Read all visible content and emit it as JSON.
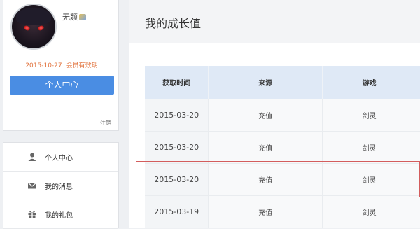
{
  "profile": {
    "username": "无颜",
    "membership_date": "2015-10-27",
    "membership_text": "会员有效期",
    "center_button": "个人中心",
    "logout": "注销"
  },
  "nav": {
    "items": [
      {
        "label": "个人中心",
        "icon": "person-icon"
      },
      {
        "label": "我的消息",
        "icon": "envelope-icon"
      },
      {
        "label": "我的礼包",
        "icon": "gift-icon"
      }
    ]
  },
  "page": {
    "title": "我的成长值"
  },
  "table": {
    "headers": [
      "获取时间",
      "来源",
      "游戏"
    ],
    "rows": [
      {
        "date": "2015-03-20",
        "source": "充值",
        "game": "剑灵"
      },
      {
        "date": "2015-03-20",
        "source": "充值",
        "game": "剑灵"
      },
      {
        "date": "2015-03-20",
        "source": "充值",
        "game": "剑灵"
      },
      {
        "date": "2015-03-19",
        "source": "充值",
        "game": "剑灵"
      }
    ],
    "highlighted_row": 2
  },
  "colors": {
    "accent_blue": "#4a8de3",
    "orange_text": "#e2733d",
    "header_row": "#dfe9f6",
    "highlight_border": "#d35d5d"
  }
}
